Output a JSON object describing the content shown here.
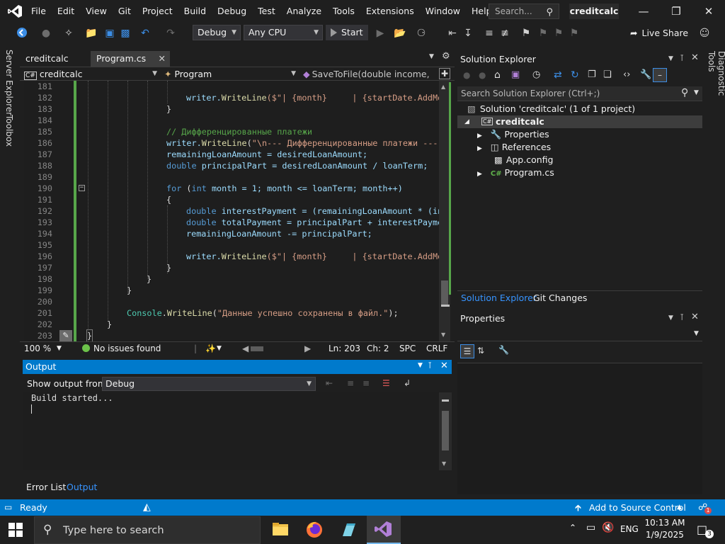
{
  "titlebar": {
    "menus": [
      "File",
      "Edit",
      "View",
      "Git",
      "Project",
      "Build",
      "Debug",
      "Test",
      "Analyze",
      "Tools",
      "Extensions",
      "Window",
      "Help"
    ],
    "search_placeholder": "Search...",
    "solution_name": "creditcalc"
  },
  "toolbar": {
    "config": "Debug",
    "platform": "Any CPU",
    "start_label": "Start",
    "live_share": "Live Share"
  },
  "side_tabs": {
    "left_1": "Server Explorer",
    "left_2": "Toolbox",
    "right": "Diagnostic Tools"
  },
  "editor": {
    "tabs": [
      {
        "label": "creditcalc"
      },
      {
        "label": "Program.cs"
      }
    ],
    "nav": {
      "project": "creditcalc",
      "class": "Program",
      "member": "SaveToFile(double income, do"
    },
    "lines": [
      {
        "n": "181"
      },
      {
        "n": "182"
      },
      {
        "n": "183"
      },
      {
        "n": "184"
      },
      {
        "n": "185"
      },
      {
        "n": "186"
      },
      {
        "n": "187"
      },
      {
        "n": "188"
      },
      {
        "n": "189"
      },
      {
        "n": "190"
      },
      {
        "n": "191"
      },
      {
        "n": "192"
      },
      {
        "n": "193"
      },
      {
        "n": "194"
      },
      {
        "n": "195"
      },
      {
        "n": "196"
      },
      {
        "n": "197"
      },
      {
        "n": "198"
      },
      {
        "n": "199"
      },
      {
        "n": "200"
      },
      {
        "n": "201"
      },
      {
        "n": "202"
      },
      {
        "n": "203"
      }
    ],
    "code": {
      "l182_a": "writer.",
      "l182_m": "WriteLine",
      "l182_b": "($\"| {month}     | {startDate.AddMo",
      "l183": "}",
      "l185": "// Дифференцированные платежи",
      "l186_a": "writer.",
      "l186_m": "WriteLine",
      "l186_b": "(",
      "l186_s": "\"\\n--- Дифференцированные платежи ---\"",
      "l187": "remainingLoanAmount = desiredLoanAmount;",
      "l188_k": "double",
      "l188_b": " principalPart = desiredLoanAmount / loanTerm;",
      "l190_k": "for",
      "l190_b": " (",
      "l190_k2": "int",
      "l190_c": " month = 1; month <= loanTerm; month++)",
      "l191": "{",
      "l192_k": "double",
      "l192_b": " interestPayment = (remainingLoanAmount * (in",
      "l193_k": "double",
      "l193_b": " totalPayment = principalPart + interestPayme",
      "l194": "remainingLoanAmount -= principalPart;",
      "l196_a": "writer.",
      "l196_m": "WriteLine",
      "l196_b": "($\"| {month}     | {startDate.AddMo",
      "l197": "}",
      "l198": "}",
      "l199": "}",
      "l201_t": "Console",
      "l201_a": ".",
      "l201_m": "WriteLine",
      "l201_b": "(",
      "l201_s": "\"Данные успешно сохранены в файл.\"",
      "l201_c": ");",
      "l202": "}",
      "l203": "}"
    },
    "status": {
      "zoom": "100 %",
      "issues": "No issues found",
      "ln": "Ln: 203",
      "ch": "Ch: 2",
      "spc": "SPC",
      "crlf": "CRLF"
    }
  },
  "output": {
    "title": "Output",
    "show_from_label": "Show output from:",
    "source": "Debug",
    "text": "Build started...",
    "tabs": [
      "Error List",
      "Output"
    ]
  },
  "solution_explorer": {
    "title": "Solution Explorer",
    "search_placeholder": "Search Solution Explorer (Ctrl+;)",
    "solution": "Solution 'creditcalc' (1 of 1 project)",
    "project": "creditcalc",
    "items": [
      "Properties",
      "References",
      "App.config",
      "Program.cs"
    ],
    "tabs": [
      "Solution Explorer",
      "Git Changes"
    ]
  },
  "properties": {
    "title": "Properties"
  },
  "statusbar": {
    "ready": "Ready",
    "source_control": "Add to Source Control",
    "notif_count": "1"
  },
  "taskbar": {
    "search_placeholder": "Type here to search",
    "lang": "ENG",
    "time": "10:13 AM",
    "date": "1/9/2025",
    "notif_count": "3"
  }
}
